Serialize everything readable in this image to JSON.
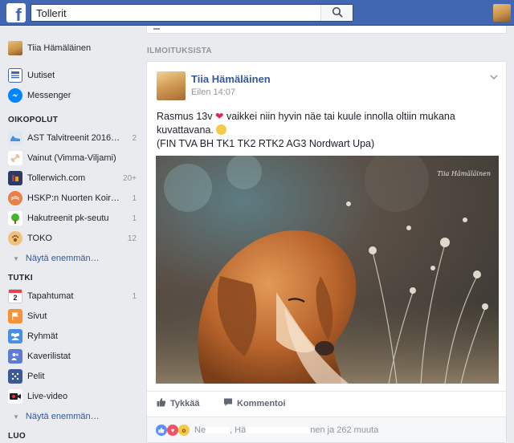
{
  "topbar": {
    "logo": "f",
    "search": {
      "value": "Tollerit",
      "placeholder": ""
    },
    "icons": {
      "search": "search-icon",
      "avatar": "profile-avatar"
    }
  },
  "sidebar": {
    "user_name": "Tiia Hämäläinen",
    "main": [
      {
        "label": "Uutiset",
        "icon": "news-feed-icon"
      },
      {
        "label": "Messenger",
        "icon": "messenger-icon"
      }
    ],
    "shortcuts_title": "OIKOPOLUT",
    "shortcuts": [
      {
        "label": "AST Talvitreenit 2016…",
        "count": "2",
        "icon": "shoe-icon"
      },
      {
        "label": "Vainut (Vimma-Viljami)",
        "count": "",
        "icon": "bone-icon"
      },
      {
        "label": "Tollerwich.com",
        "count": "20+",
        "icon": "page-icon"
      },
      {
        "label": "HSKP:n Nuorten Koir…",
        "count": "1",
        "icon": "ball-icon"
      },
      {
        "label": "Hakutreenit pk-seutu",
        "count": "1",
        "icon": "tree-icon"
      },
      {
        "label": "TOKO",
        "count": "12",
        "icon": "paw-icon"
      }
    ],
    "shortcuts_more": "Näytä enemmän…",
    "explore_title": "TUTKI",
    "explore": [
      {
        "label": "Tapahtumat",
        "count": "1",
        "icon": "calendar-icon",
        "icon_text": "2"
      },
      {
        "label": "Sivut",
        "count": "",
        "icon": "flag-icon"
      },
      {
        "label": "Ryhmät",
        "count": "",
        "icon": "groups-icon"
      },
      {
        "label": "Kaverilistat",
        "count": "",
        "icon": "friends-list-icon"
      },
      {
        "label": "Pelit",
        "count": "",
        "icon": "games-icon"
      },
      {
        "label": "Live-video",
        "count": "",
        "icon": "live-video-icon"
      }
    ],
    "explore_more": "Näytä enemmän…",
    "create_title": "LUO"
  },
  "feed": {
    "section_title": "ILMOITUKSISTA",
    "post": {
      "author": "Tiia Hämäläinen",
      "time": "Eilen 14:07",
      "text_part1": "Rasmus 13v",
      "text_part2": "vaikkei niin hyvin näe tai kuule innolla oltiin mukana kuvattavana.",
      "text_line3": "(FIN TVA BH TK1 TK2 RTK2 AG3 Nordwart Upa)",
      "photo_watermark": "Tiia Hämäläinen",
      "like_label": "Tykkää",
      "comment_label": "Kommentoi",
      "reactions": {
        "names_1": "Ne",
        "names_2": ", Hä",
        "names_3": "nen ja 262 muuta"
      }
    }
  },
  "colors": {
    "brand": "#4267b2",
    "link": "#365899",
    "background": "#e9ebee",
    "like": "#5890ff",
    "love": "#f25268",
    "wow": "#f7c948"
  }
}
